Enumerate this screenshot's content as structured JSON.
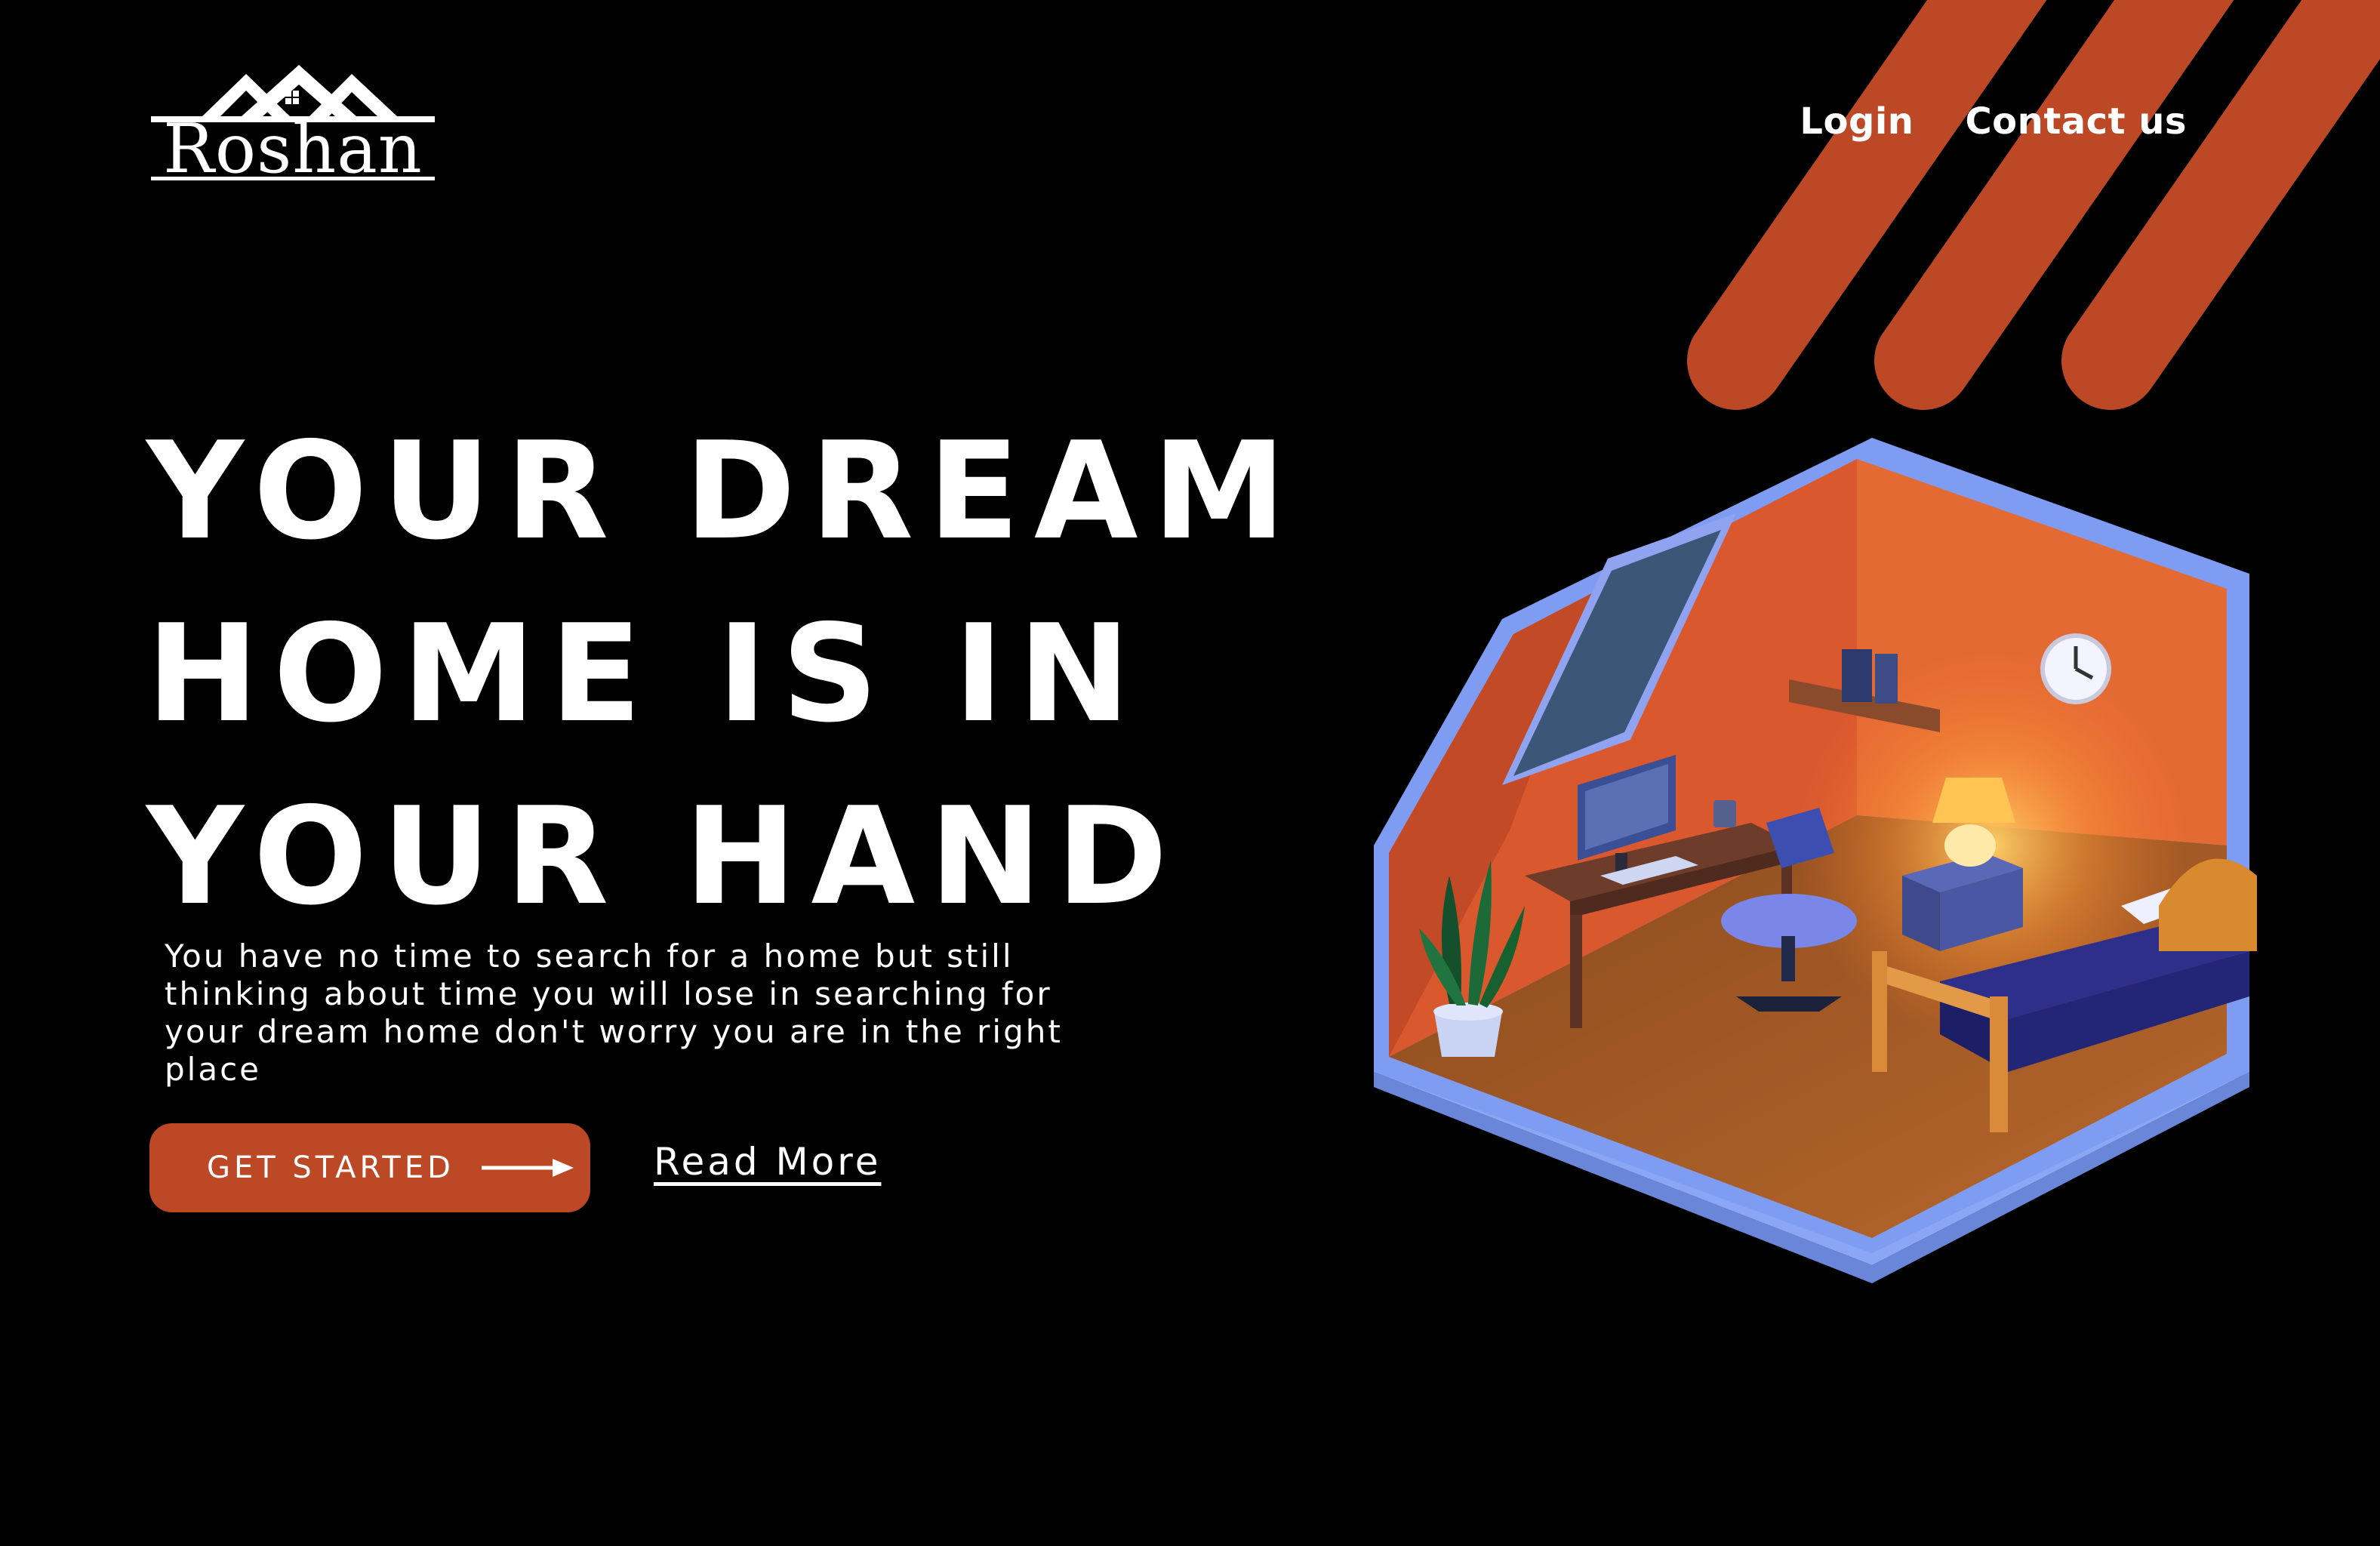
{
  "brand": {
    "name": "Roshan"
  },
  "nav": {
    "login": "Login",
    "contact": "Contact us"
  },
  "hero": {
    "headline_lines": [
      "YOUR DREAM",
      "HOME IS IN",
      "YOUR HAND"
    ],
    "description": "You have no time to search for a home but still thinking about time you will lose in searching for your dream home don't worry you are in the right place",
    "cta_label": "GET STARTED",
    "read_more": "Read More"
  },
  "colors": {
    "background": "#000000",
    "accent": "#bd4826",
    "room_frame": "#7e9df2",
    "text": "#ffffff"
  },
  "icons": {
    "cta_arrow": "arrow-right-icon",
    "logo_mark": "house-roof-icon"
  }
}
